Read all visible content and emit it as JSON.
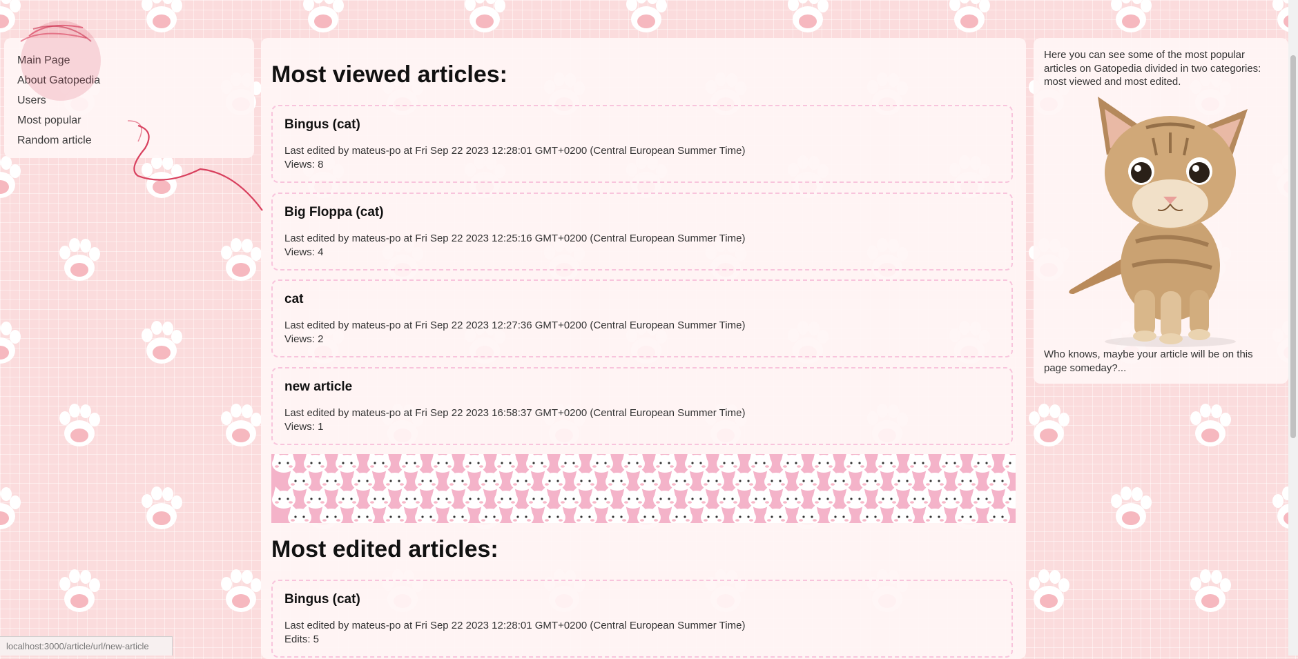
{
  "nav": {
    "items": [
      {
        "label": "Main Page"
      },
      {
        "label": "About Gatopedia"
      },
      {
        "label": "Users"
      },
      {
        "label": "Most popular"
      },
      {
        "label": "Random article"
      }
    ]
  },
  "main": {
    "most_viewed_title": "Most viewed articles:",
    "most_viewed": [
      {
        "title": "Bingus (cat)",
        "meta": "Last edited by mateus-po at Fri Sep 22 2023 12:28:01 GMT+0200 (Central European Summer Time)",
        "count": "Views: 8"
      },
      {
        "title": "Big Floppa (cat)",
        "meta": "Last edited by mateus-po at Fri Sep 22 2023 12:25:16 GMT+0200 (Central European Summer Time)",
        "count": "Views: 4"
      },
      {
        "title": "cat",
        "meta": "Last edited by mateus-po at Fri Sep 22 2023 12:27:36 GMT+0200 (Central European Summer Time)",
        "count": "Views: 2"
      },
      {
        "title": "new article",
        "meta": "Last edited by mateus-po at Fri Sep 22 2023 16:58:37 GMT+0200 (Central European Summer Time)",
        "count": "Views: 1"
      }
    ],
    "most_edited_title": "Most edited articles:",
    "most_edited": [
      {
        "title": "Bingus (cat)",
        "meta": "Last edited by mateus-po at Fri Sep 22 2023 12:28:01 GMT+0200 (Central European Summer Time)",
        "count": "Edits: 5"
      }
    ]
  },
  "sidebar_right": {
    "intro": "Here you can see some of the most popular articles on Gatopedia divided in two categories: most viewed and most edited.",
    "outro": "Who knows, maybe your article will be on this page someday?...",
    "image_icon": "kitten-image"
  },
  "status_bar": {
    "url": "localhost:3000/article/url/new-article"
  },
  "colors": {
    "background": "#fbdcdd",
    "paw": "#ffffff",
    "paw_pad": "#f6b8bf",
    "card_border": "#f8c4dc",
    "banner": "#f4b3c9",
    "yarn": "#d8405e"
  }
}
